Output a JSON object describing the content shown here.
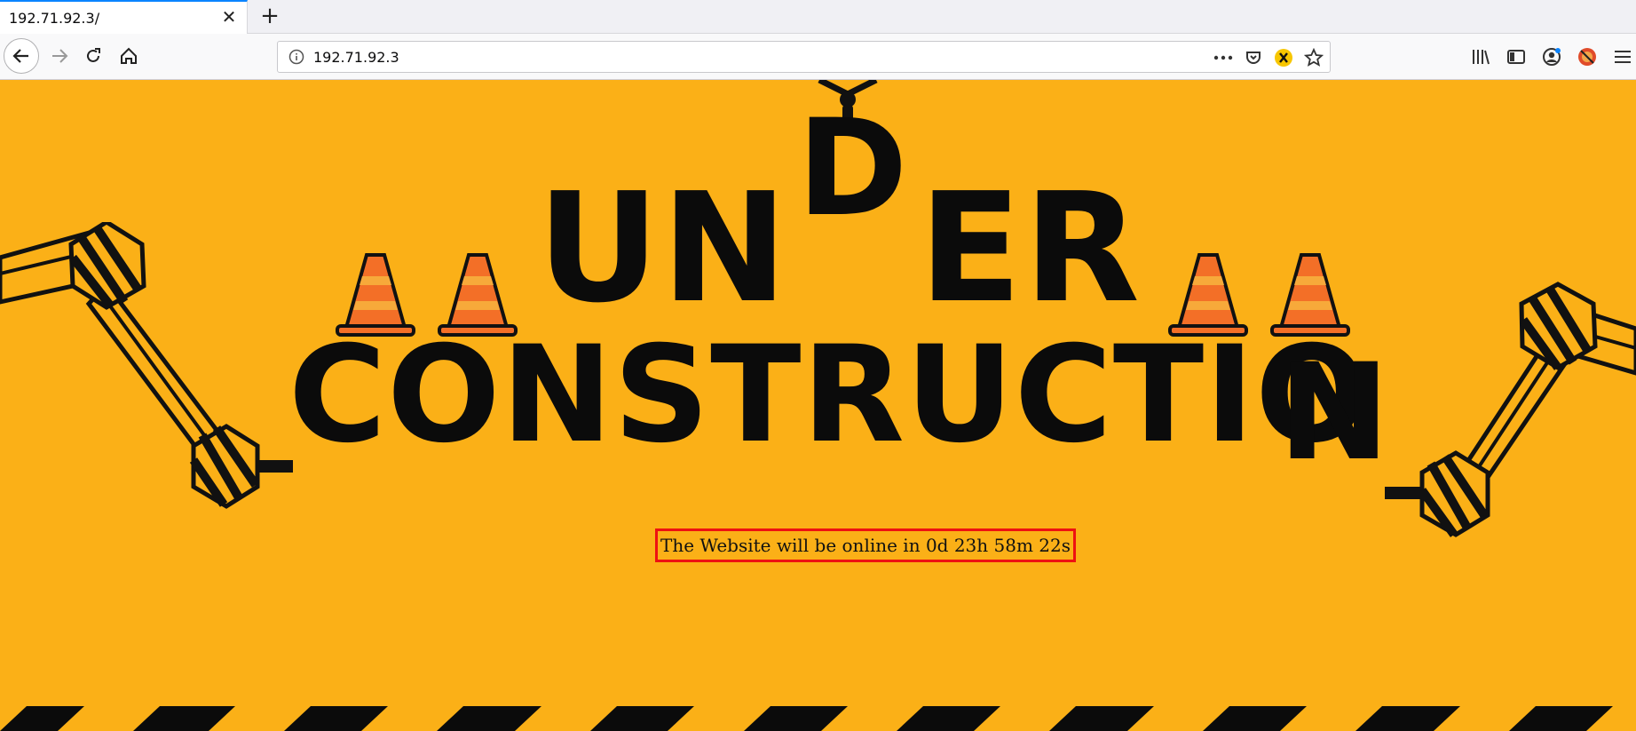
{
  "browser": {
    "tab_title": "192.71.92.3/",
    "url": "192.71.92.3"
  },
  "icons": {
    "tab_close": "close-icon",
    "new_tab": "plus-icon",
    "back": "back-arrow-icon",
    "forward": "forward-arrow-icon",
    "reload": "reload-icon",
    "home": "home-icon",
    "site_info": "info-icon",
    "page_actions": "more-icon",
    "pocket": "pocket-icon",
    "extension": "extension-icon",
    "bookmark": "star-icon",
    "library": "library-icon",
    "sidebar": "sidebar-icon",
    "account": "account-icon",
    "blocked": "blocked-icon",
    "menu": "hamburger-menu-icon"
  },
  "page": {
    "word1_left": "UN",
    "word1_d": "D",
    "word1_right": "ER",
    "word2_main": "CONSTRUCTIO",
    "word2_last": "N",
    "countdown_text": "The Website will be online in 0d 23h 58m 22s"
  },
  "colors": {
    "background": "#fbb017",
    "ink": "#0b0b0b",
    "cone": "#f36f27",
    "cone_stripe": "#f7a93a",
    "highlight": "#e11111"
  }
}
